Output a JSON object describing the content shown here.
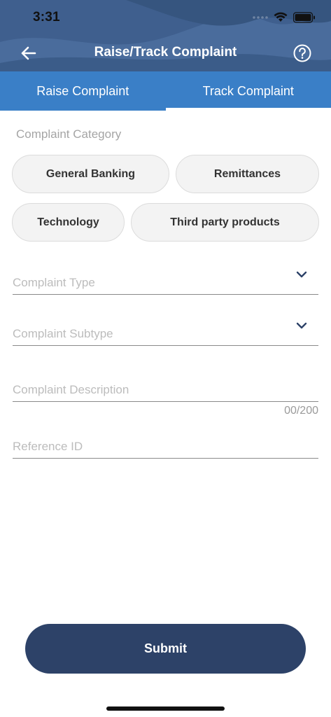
{
  "status_bar": {
    "time": "3:31"
  },
  "header": {
    "title": "Raise/Track Complaint",
    "back_icon": "arrow-left-icon",
    "help_icon": "question-circle-icon"
  },
  "tabs": [
    {
      "label": "Raise Complaint",
      "active": false
    },
    {
      "label": "Track Complaint",
      "active": true
    }
  ],
  "category": {
    "label": "Complaint Category",
    "chips": [
      "General Banking",
      "Remittances",
      "Technology",
      "Third party products"
    ]
  },
  "form": {
    "complaint_type_placeholder": "Complaint Type",
    "complaint_subtype_placeholder": "Complaint Subtype",
    "description_placeholder": "Complaint Description",
    "description_counter": "00/200",
    "reference_placeholder": "Reference ID"
  },
  "submit_label": "Submit",
  "colors": {
    "header_bg": "#3f5f8e",
    "tab_bg": "#3a7fc7",
    "submit_bg": "#2d4268",
    "chip_bg": "#f3f3f3"
  }
}
